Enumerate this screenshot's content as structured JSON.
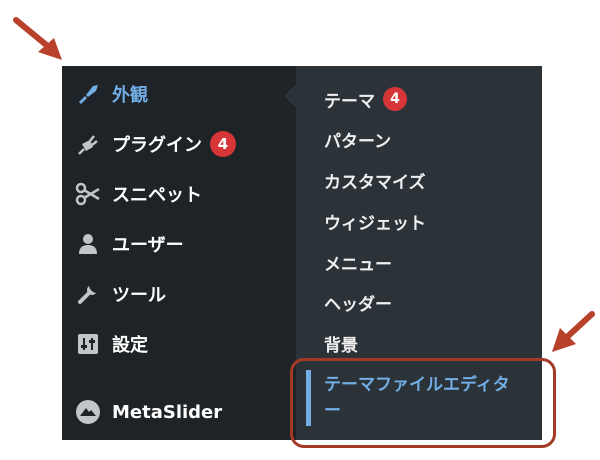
{
  "sidebar": {
    "items": [
      {
        "label": "外観",
        "icon": "paintbrush-icon",
        "active": true
      },
      {
        "label": "プラグイン",
        "icon": "plugin-icon",
        "badge": "4"
      },
      {
        "label": "スニペット",
        "icon": "scissors-icon"
      },
      {
        "label": "ユーザー",
        "icon": "user-icon"
      },
      {
        "label": "ツール",
        "icon": "wrench-icon"
      },
      {
        "label": "設定",
        "icon": "settings-icon"
      },
      {
        "label": "MetaSlider",
        "icon": "metaslider-icon"
      }
    ]
  },
  "submenu": {
    "items": [
      {
        "label": "テーマ",
        "badge": "4"
      },
      {
        "label": "パターン"
      },
      {
        "label": "カスタマイズ"
      },
      {
        "label": "ウィジェット"
      },
      {
        "label": "メニュー"
      },
      {
        "label": "ヘッダー"
      },
      {
        "label": "背景"
      }
    ],
    "current": {
      "label": "テーマファイルエディター"
    }
  },
  "colors": {
    "sidebar_bg": "#1e2327",
    "submenu_bg": "#2c3338",
    "accent": "#72aee6",
    "badge": "#d63638",
    "annotation": "#a33a26"
  }
}
